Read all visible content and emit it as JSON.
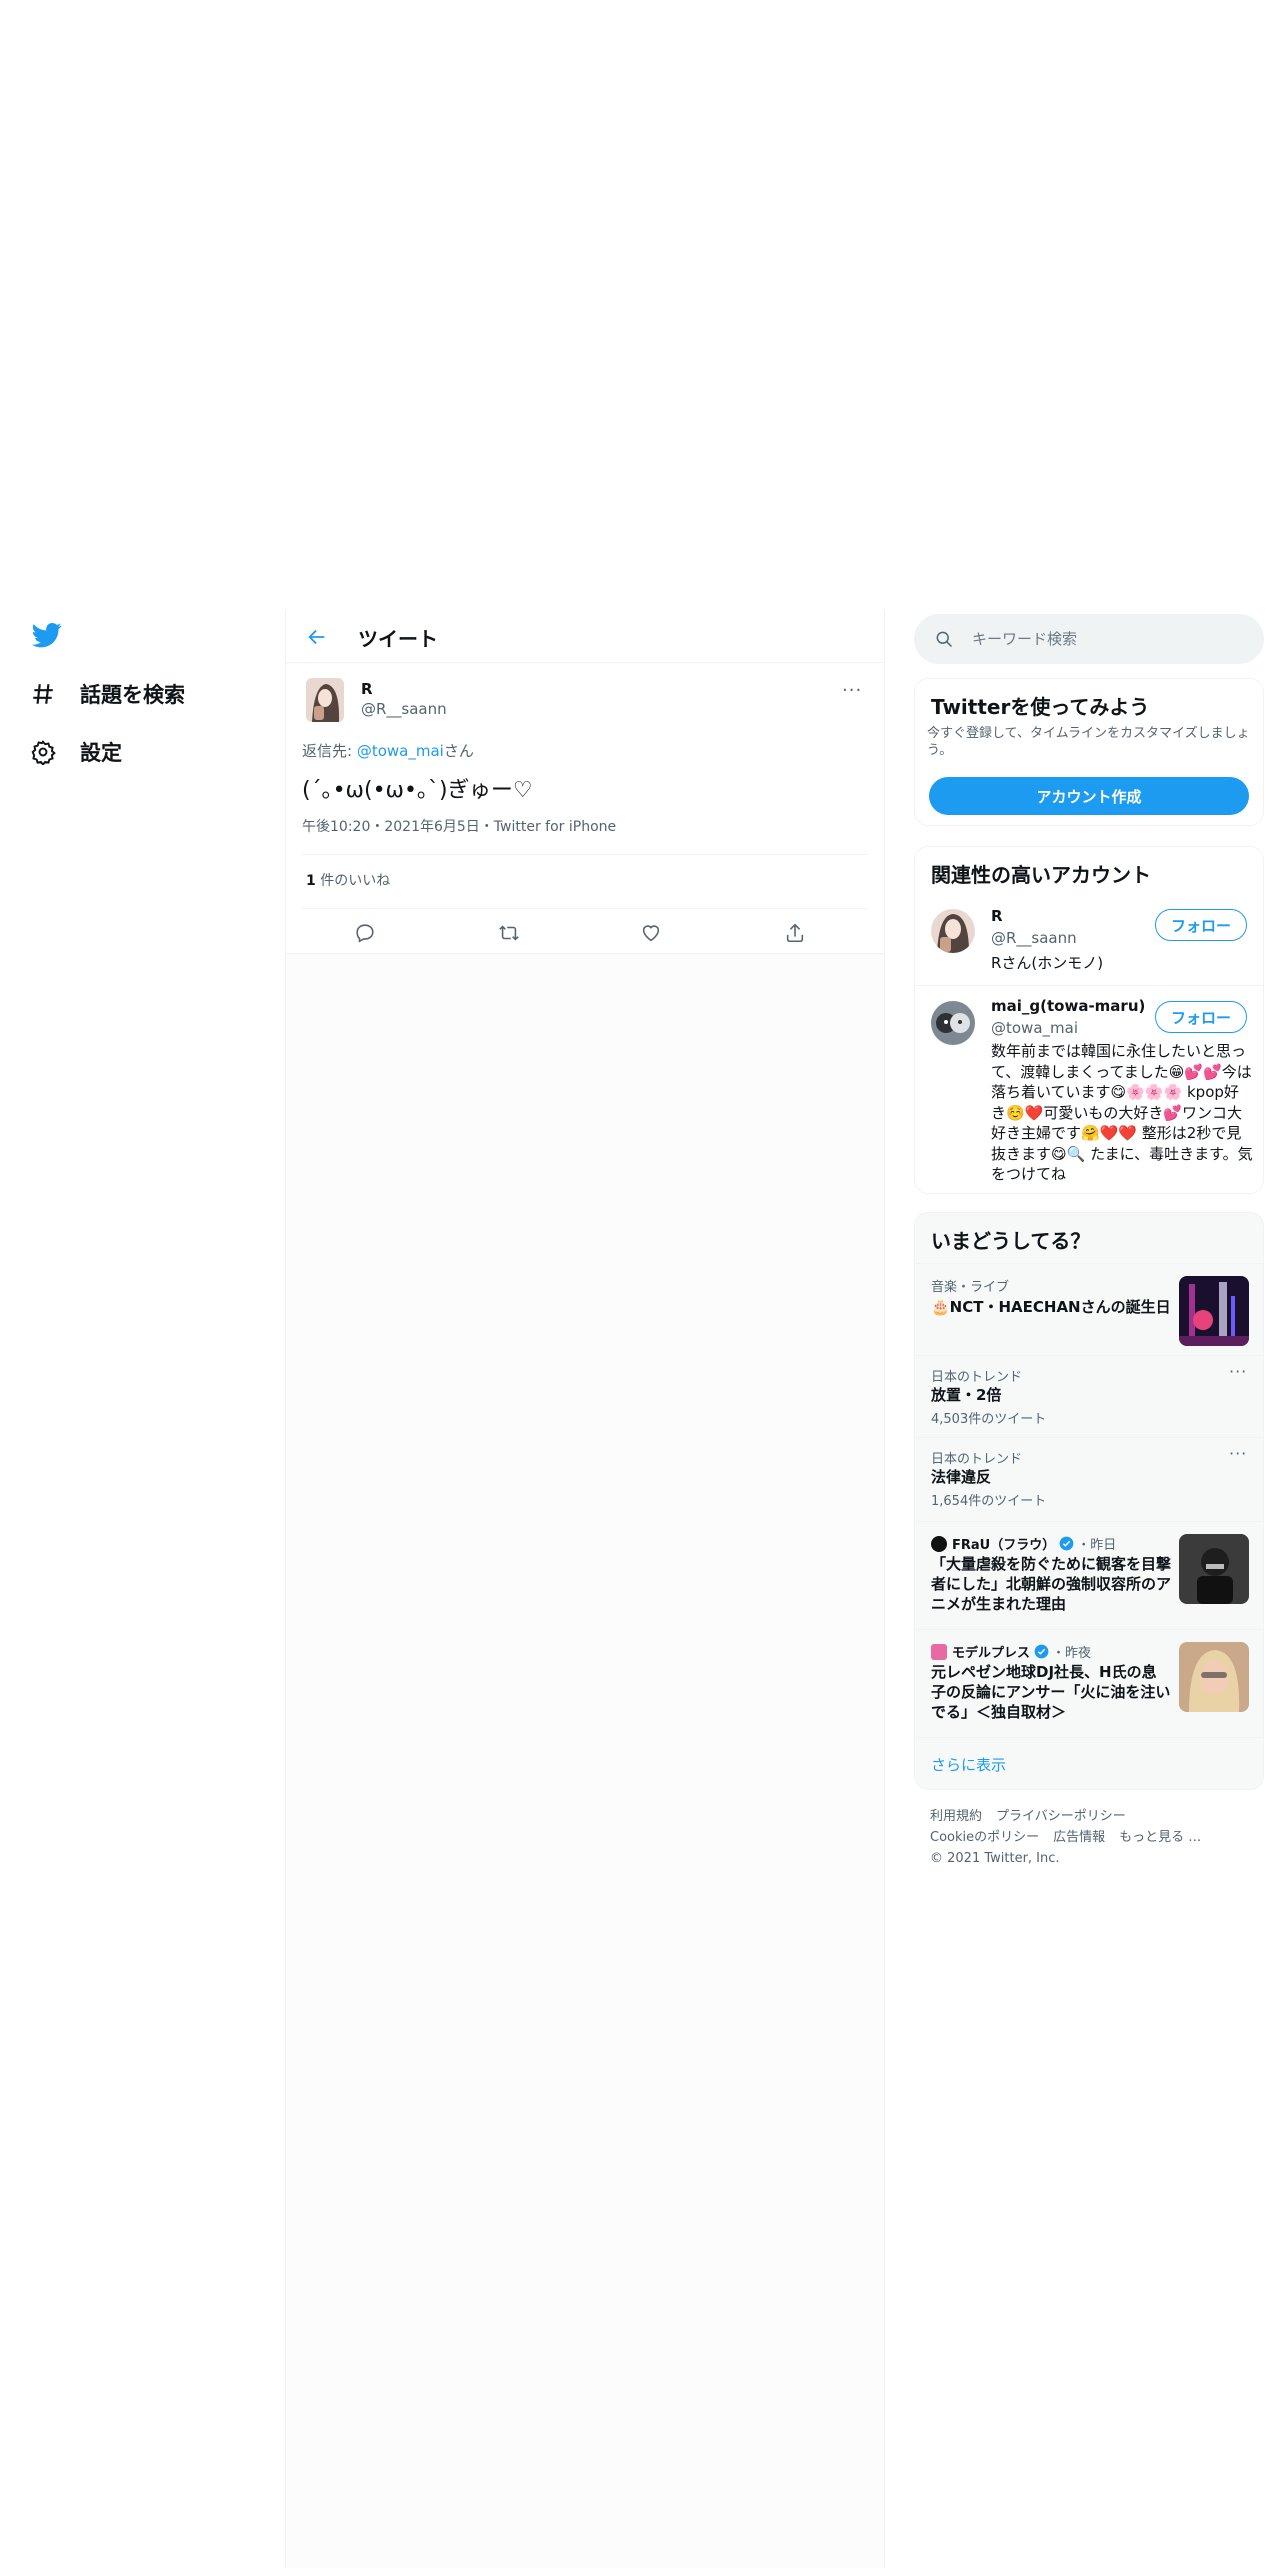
{
  "nav": {
    "items": [
      {
        "label": "話題を検索",
        "icon": "hashtag-icon"
      },
      {
        "label": "設定",
        "icon": "gear-icon"
      }
    ]
  },
  "header": {
    "title": "ツイート"
  },
  "tweet": {
    "name": "R",
    "handle": "@R__saann",
    "reply_prefix": "返信先: ",
    "reply_to": "@towa_mai",
    "reply_suffix": "さん",
    "text": "(´｡•ω(•ω•｡`)ぎゅー♡",
    "meta": "午後10:20・2021年6月5日・Twitter for iPhone",
    "likes_count": "1",
    "likes_label": " 件のいいね"
  },
  "search": {
    "placeholder": "キーワード検索"
  },
  "signup": {
    "title": "Twitterを使ってみよう",
    "desc": "今すぐ登録して、タイムラインをカスタマイズしましょう。",
    "button": "アカウント作成"
  },
  "related": {
    "title": "関連性の高いアカウント",
    "follow_label": "フォロー",
    "accounts": [
      {
        "name": "R",
        "handle": "@R__saann",
        "bio": "Rさん(ホンモノ)"
      },
      {
        "name": "mai_g(towa-maru)",
        "handle": "@towa_mai",
        "bio": "数年前までは韓国に永住したいと思って、渡韓しまくってました😁💕💕今は落ち着いています😋🌸🌸🌸 kpop好き☺️❤️可愛いもの大好き💕ワンコ大好き主婦です🤗❤️❤️ 整形は2秒で見抜きます😋🔍 たまに、毒吐きます。気をつけてね"
      }
    ]
  },
  "trends": {
    "title": "いまどうしてる？",
    "items": [
      {
        "category": "音楽・ライブ",
        "name": "🎂NCT・HAECHANさんの誕生日"
      },
      {
        "category": "日本のトレンド",
        "name": "放置・2倍",
        "count": "4,503件のツイート"
      },
      {
        "category": "日本のトレンド",
        "name": "法律違反",
        "count": "1,654件のツイート"
      }
    ],
    "news": [
      {
        "source": "FRaU（フラウ）",
        "time": "・昨日",
        "headline": "「大量虐殺を防ぐために観客を目撃者にした」北朝鮮の強制収容所のアニメが生まれた理由"
      },
      {
        "source": "モデルプレス",
        "time": "・昨夜",
        "headline": "元レペゼン地球DJ社長、H氏の息子の反論にアンサー「火に油を注いでる」＜独自取材＞"
      }
    ],
    "show_more": "さらに表示"
  },
  "footer": {
    "links": [
      "利用規約",
      "プライバシーポリシー",
      "Cookieのポリシー",
      "広告情報",
      "もっと見る …"
    ],
    "copyright": "© 2021 Twitter, Inc."
  },
  "colors": {
    "accent": "#1d9bf0",
    "text": "#0f1419",
    "muted": "#536471"
  }
}
